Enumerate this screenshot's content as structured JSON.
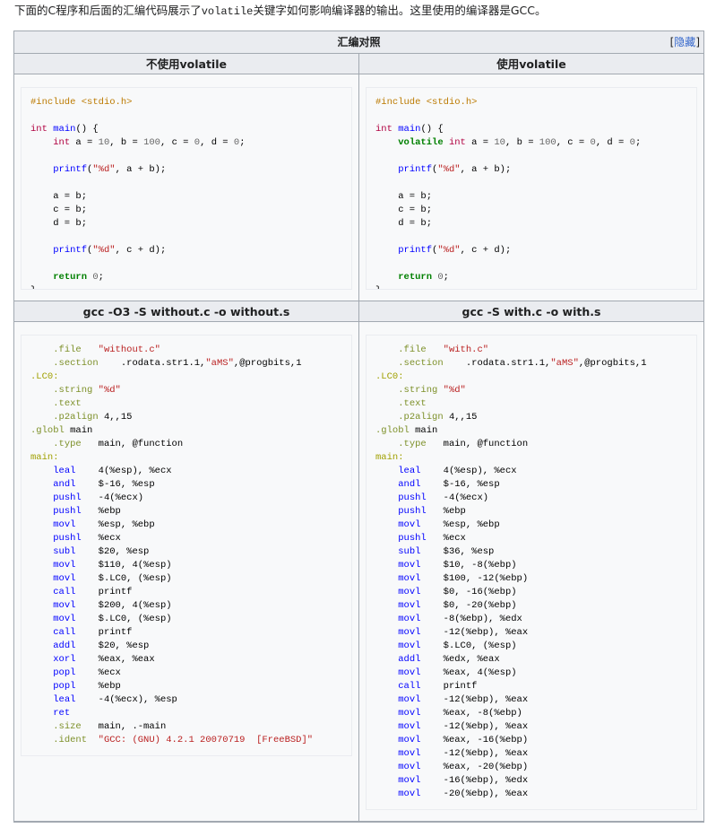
{
  "intro": {
    "before": "下面的C程序和后面的汇编代码展示了",
    "code": "volatile",
    "after": "关键字如何影响编译器的输出。这里使用的编译器是GCC。"
  },
  "table": {
    "caption": "汇编对照",
    "toggle_left": "[",
    "toggle_link": "隐藏",
    "toggle_right": "]",
    "col1_header": "不使用volatile",
    "col2_header": "使用volatile",
    "asm1_header": "gcc -O3 -S without.c -o without.s",
    "asm2_header": "gcc -S with.c -o with.s"
  },
  "c_without": [
    "#include <stdio.h>",
    "",
    "int main() {",
    "    int a = 10, b = 100, c = 0, d = 0;",
    "",
    "    printf(\"%d\", a + b);",
    "",
    "    a = b;",
    "    c = b;",
    "    d = b;",
    "",
    "    printf(\"%d\", c + d);",
    "",
    "    return 0;",
    "}"
  ],
  "c_with": [
    "#include <stdio.h>",
    "",
    "int main() {",
    "    volatile int a = 10, b = 100, c = 0, d = 0;",
    "",
    "    printf(\"%d\", a + b);",
    "",
    "    a = b;",
    "    c = b;",
    "    d = b;",
    "",
    "    printf(\"%d\", c + d);",
    "",
    "    return 0;",
    "}"
  ],
  "asm_without": [
    "    .file   \"without.c\"",
    "    .section    .rodata.str1.1,\"aMS\",@progbits,1",
    ".LC0:",
    "    .string \"%d\"",
    "    .text",
    "    .p2align 4,,15",
    ".globl main",
    "    .type   main, @function",
    "main:",
    "    leal    4(%esp), %ecx",
    "    andl    $-16, %esp",
    "    pushl   -4(%ecx)",
    "    pushl   %ebp",
    "    movl    %esp, %ebp",
    "    pushl   %ecx",
    "    subl    $20, %esp",
    "    movl    $110, 4(%esp)",
    "    movl    $.LC0, (%esp)",
    "    call    printf",
    "    movl    $200, 4(%esp)",
    "    movl    $.LC0, (%esp)",
    "    call    printf",
    "    addl    $20, %esp",
    "    xorl    %eax, %eax",
    "    popl    %ecx",
    "    popl    %ebp",
    "    leal    -4(%ecx), %esp",
    "    ret",
    "    .size   main, .-main",
    "    .ident  \"GCC: (GNU) 4.2.1 20070719  [FreeBSD]\""
  ],
  "asm_with": [
    "    .file   \"with.c\"",
    "    .section    .rodata.str1.1,\"aMS\",@progbits,1",
    ".LC0:",
    "    .string \"%d\"",
    "    .text",
    "    .p2align 4,,15",
    ".globl main",
    "    .type   main, @function",
    "main:",
    "    leal    4(%esp), %ecx",
    "    andl    $-16, %esp",
    "    pushl   -4(%ecx)",
    "    pushl   %ebp",
    "    movl    %esp, %ebp",
    "    pushl   %ecx",
    "    subl    $36, %esp",
    "    movl    $10, -8(%ebp)",
    "    movl    $100, -12(%ebp)",
    "    movl    $0, -16(%ebp)",
    "    movl    $0, -20(%ebp)",
    "    movl    -8(%ebp), %edx",
    "    movl    -12(%ebp), %eax",
    "    movl    $.LC0, (%esp)",
    "    addl    %edx, %eax",
    "    movl    %eax, 4(%esp)",
    "    call    printf",
    "    movl    -12(%ebp), %eax",
    "    movl    %eax, -8(%ebp)",
    "    movl    -12(%ebp), %eax",
    "    movl    %eax, -16(%ebp)",
    "    movl    -12(%ebp), %eax",
    "    movl    %eax, -20(%ebp)",
    "    movl    -16(%ebp), %edx",
    "    movl    -20(%ebp), %eax"
  ]
}
